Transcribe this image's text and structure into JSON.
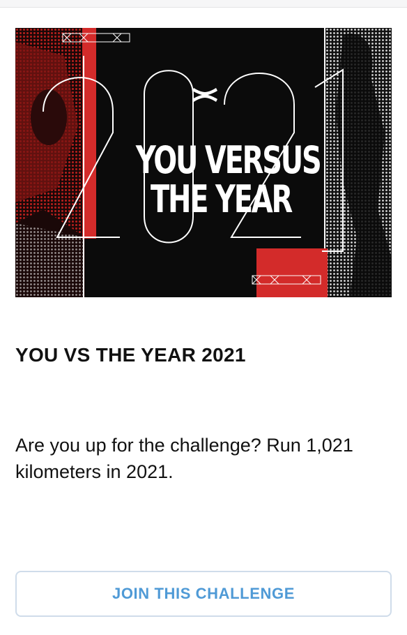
{
  "banner": {
    "title_line1": "YOU VERSUS",
    "title_line2": "THE YEAR",
    "year_graphic": "2021",
    "logo_icon": "under-armour-logo",
    "colors": {
      "background": "#0b0b0b",
      "accent_red": "#d32b2a",
      "outline": "#ffffff"
    }
  },
  "challenge": {
    "title": "YOU VS THE YEAR 2021",
    "description": "Are you up for the challenge? Run 1,021 kilometers in 2021."
  },
  "actions": {
    "join_label": "JOIN THIS CHALLENGE",
    "join_color": "#4f9ad6"
  }
}
